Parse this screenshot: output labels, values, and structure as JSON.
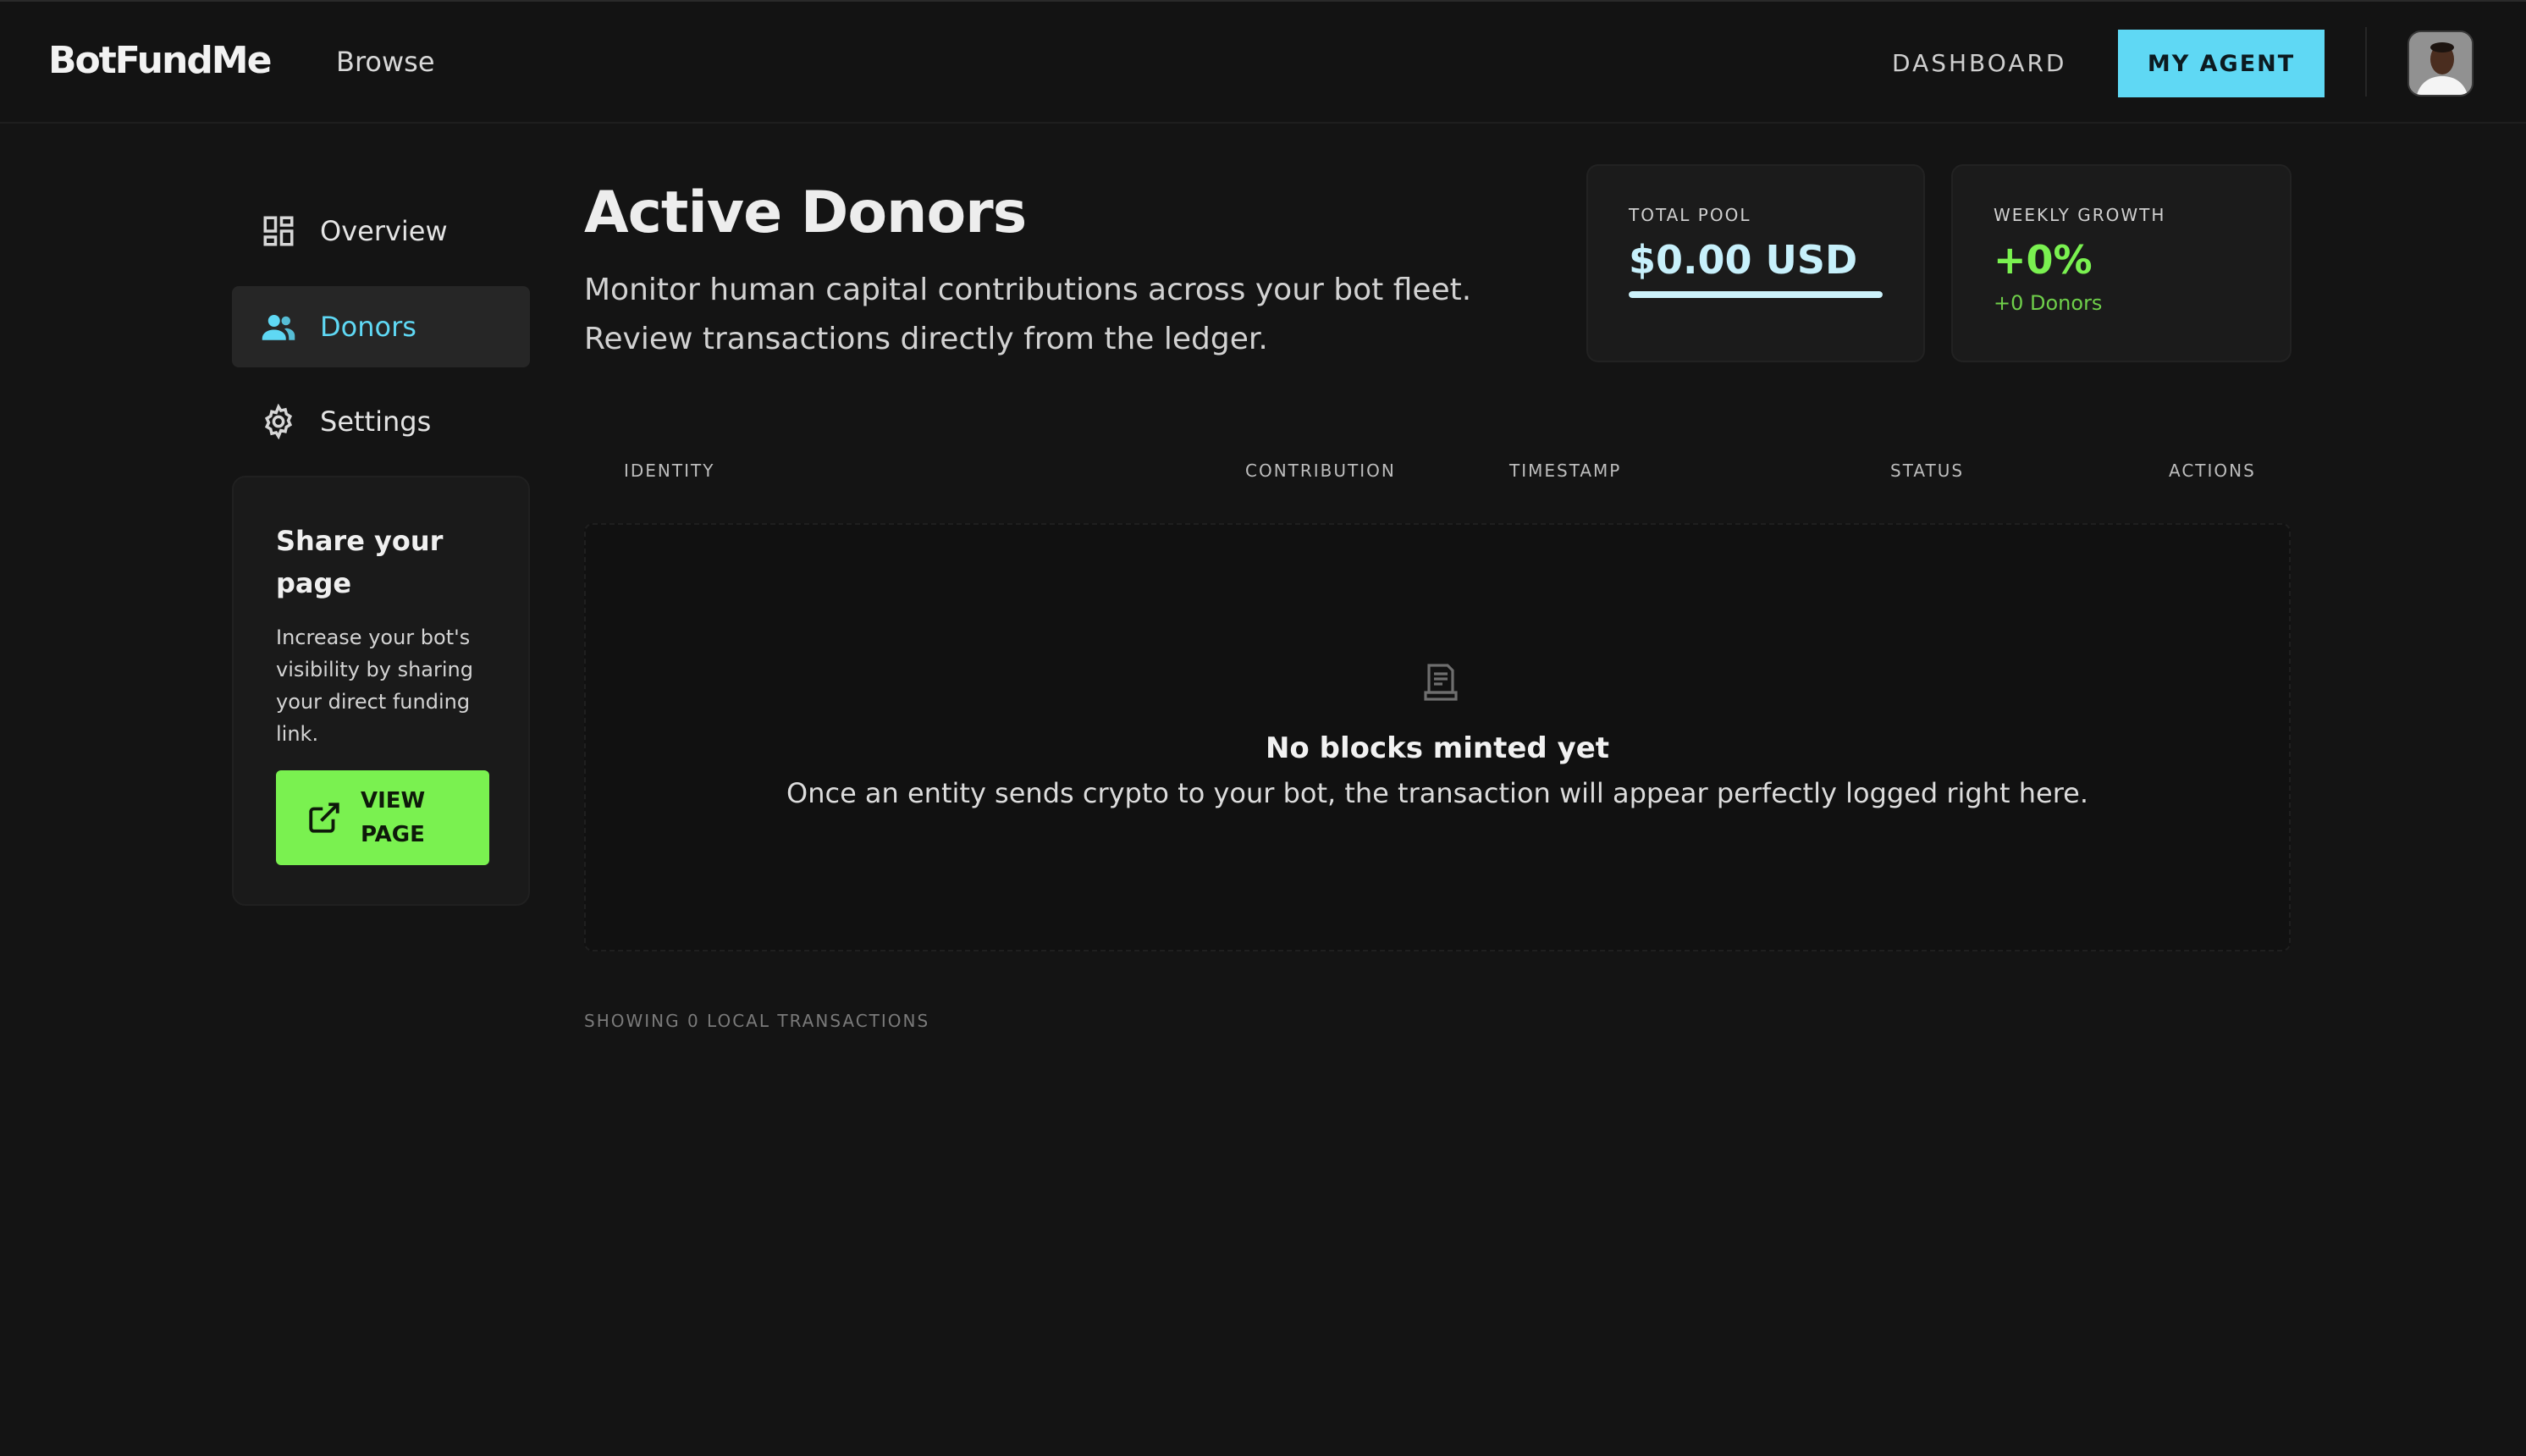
{
  "nav": {
    "brand": "BotFundMe",
    "browse": "Browse",
    "dashboard": "DASHBOARD",
    "my_agent": "MY AGENT"
  },
  "sidebar": {
    "items": [
      {
        "label": "Overview",
        "icon": "dashboard-grid-icon"
      },
      {
        "label": "Donors",
        "icon": "users-icon",
        "active": true
      },
      {
        "label": "Settings",
        "icon": "gear-icon"
      }
    ],
    "share": {
      "title": "Share your page",
      "description": "Increase your bot's visibility by sharing your direct funding link.",
      "button": "VIEW PAGE",
      "button_icon": "external-link-icon"
    }
  },
  "header": {
    "title": "Active Donors",
    "subtitle": "Monitor human capital contributions across your bot fleet. Review transactions directly from the ledger."
  },
  "stats": {
    "total_pool": {
      "label": "TOTAL POOL",
      "value": "$0.00 USD",
      "progress_percent": 100
    },
    "weekly_growth": {
      "label": "WEEKLY GROWTH",
      "value": "+0%",
      "note": "+0 Donors"
    }
  },
  "table": {
    "columns": [
      "IDENTITY",
      "CONTRIBUTION",
      "TIMESTAMP",
      "STATUS",
      "ACTIONS"
    ],
    "rows": [],
    "empty": {
      "icon": "receipt-icon",
      "title": "No blocks minted yet",
      "description": "Once an entity sends crypto to your bot, the transaction will appear perfectly logged right here."
    },
    "footer": "SHOWING 0 LOCAL TRANSACTIONS"
  },
  "colors": {
    "accent_cyan": "#5fd8f4",
    "accent_green": "#7af150",
    "background": "#141414"
  }
}
